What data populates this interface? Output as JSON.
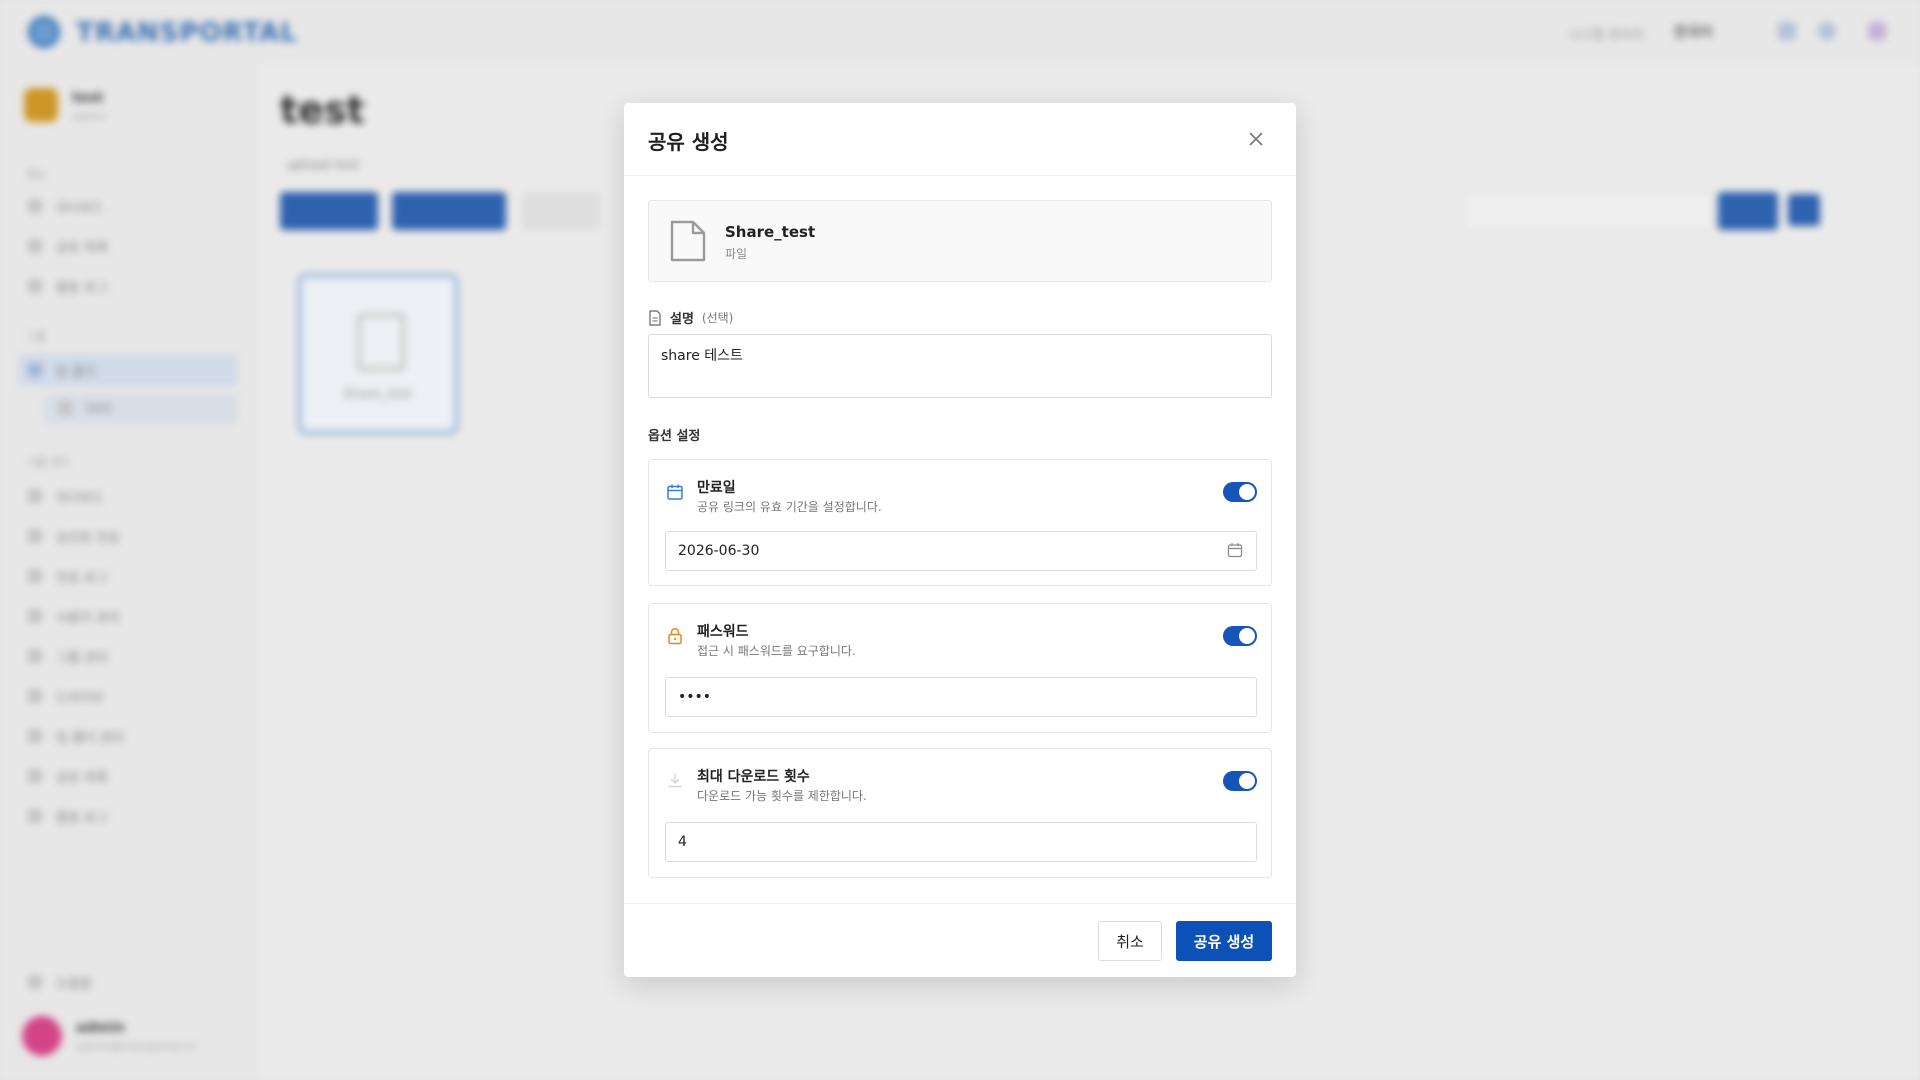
{
  "background": {
    "app_name": "TRANSPORTAL",
    "header": {
      "admin_link": "시스템 관리자",
      "language": "한국어"
    },
    "workspace": {
      "name": "test",
      "sub": "admin"
    },
    "sidebar": {
      "section_1": "메뉴",
      "items_1": [
        "대시보드",
        "공유 목록",
        "활동 로그"
      ],
      "section_2": "그룹",
      "group_item": "팀 폴더",
      "group_child": "test",
      "section_3": "그룹 관리",
      "items_3": [
        "대시보드",
        "승인된 전송",
        "전송 로그",
        "사용자 관리",
        "그룹 관리",
        "드라이브",
        "팀 폴더 관리",
        "공유 목록",
        "활동 로그"
      ],
      "help": "도움말",
      "user_name": "admin",
      "user_email": "admin@transportal.io"
    },
    "page": {
      "title": "test",
      "breadcrumb": "upload test",
      "upload_button": "업로드",
      "folder_button": "폴더생성",
      "move_button": "열기",
      "search_placeholder": "검색",
      "search_button": "검색",
      "file_card_name": "Share_test"
    }
  },
  "modal": {
    "title": "공유 생성",
    "file": {
      "name": "Share_test",
      "type": "파일"
    },
    "description": {
      "label": "설명",
      "optional": "(선택)",
      "value": "share 테스트"
    },
    "options_title": "옵션 설정",
    "expiry": {
      "title": "만료일",
      "desc": "공유 링크의 유효 기간을 설정합니다.",
      "enabled": true,
      "value": "2026-06-30"
    },
    "password": {
      "title": "패스워드",
      "desc": "접근 시 패스워드를 요구합니다.",
      "enabled": true,
      "value": "••••"
    },
    "max_downloads": {
      "title": "최대 다운로드 횟수",
      "desc": "다운로드 가능 횟수를 제한합니다.",
      "enabled": true,
      "value": "4"
    },
    "cancel_label": "취소",
    "create_label": "공유 생성"
  },
  "colors": {
    "primary": "#0d50b7",
    "toggle_on": "#1554b8",
    "calendar_icon": "#3a7bd5",
    "lock_icon": "#e08a1e"
  }
}
